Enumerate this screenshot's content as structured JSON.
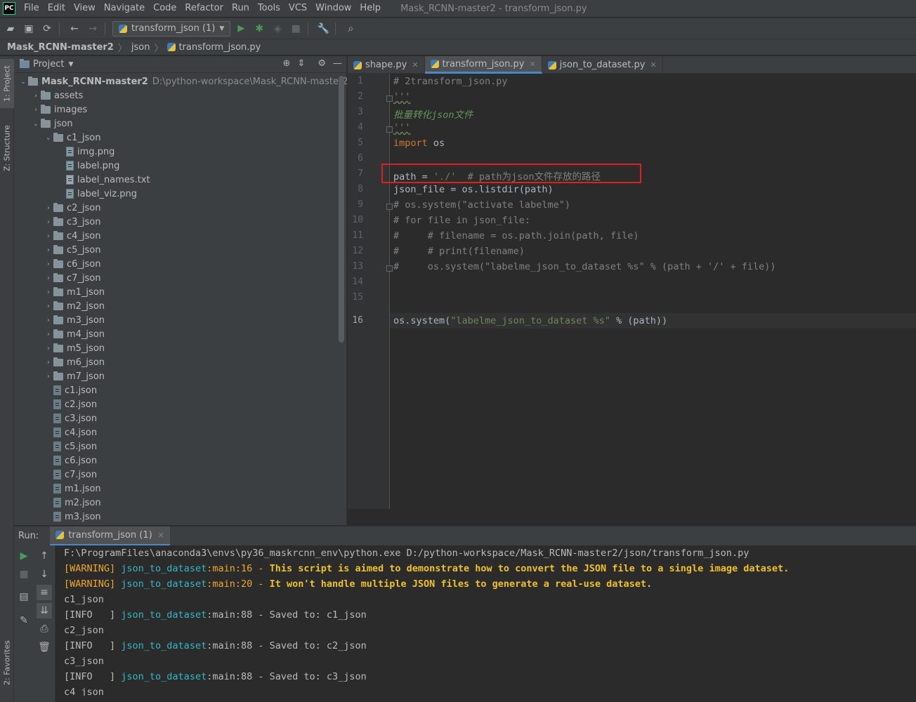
{
  "app": {
    "logo": "PC",
    "window_title": "Mask_RCNN-master2 - transform_json.py"
  },
  "menu": [
    "File",
    "Edit",
    "View",
    "Navigate",
    "Code",
    "Refactor",
    "Run",
    "Tools",
    "VCS",
    "Window",
    "Help"
  ],
  "toolbar": {
    "run_config": "transform_json (1)"
  },
  "breadcrumb": [
    "Mask_RCNN-master2",
    "json",
    "transform_json.py"
  ],
  "side_tabs": {
    "project": "1: Project",
    "structure": "Z: Structure",
    "favorites": "2: Favorites"
  },
  "project": {
    "header": "Project",
    "root_name": "Mask_RCNN-master2",
    "root_path": "D:\\python-workspace\\Mask_RCNN-master2",
    "tree": [
      {
        "label": "assets",
        "type": "folder",
        "level": 1,
        "expanded": false
      },
      {
        "label": "images",
        "type": "folder",
        "level": 1,
        "expanded": false
      },
      {
        "label": "json",
        "type": "folder",
        "level": 1,
        "expanded": true
      },
      {
        "label": "c1_json",
        "type": "folder",
        "level": 2,
        "expanded": true
      },
      {
        "label": "img.png",
        "type": "img",
        "level": 3
      },
      {
        "label": "label.png",
        "type": "img",
        "level": 3
      },
      {
        "label": "label_names.txt",
        "type": "txt",
        "level": 3
      },
      {
        "label": "label_viz.png",
        "type": "img",
        "level": 3
      },
      {
        "label": "c2_json",
        "type": "folder",
        "level": 2,
        "expanded": false
      },
      {
        "label": "c3_json",
        "type": "folder",
        "level": 2,
        "expanded": false
      },
      {
        "label": "c4_json",
        "type": "folder",
        "level": 2,
        "expanded": false
      },
      {
        "label": "c5_json",
        "type": "folder",
        "level": 2,
        "expanded": false
      },
      {
        "label": "c6_json",
        "type": "folder",
        "level": 2,
        "expanded": false
      },
      {
        "label": "c7_json",
        "type": "folder",
        "level": 2,
        "expanded": false
      },
      {
        "label": "m1_json",
        "type": "folder",
        "level": 2,
        "expanded": false
      },
      {
        "label": "m2_json",
        "type": "folder",
        "level": 2,
        "expanded": false
      },
      {
        "label": "m3_json",
        "type": "folder",
        "level": 2,
        "expanded": false
      },
      {
        "label": "m4_json",
        "type": "folder",
        "level": 2,
        "expanded": false
      },
      {
        "label": "m5_json",
        "type": "folder",
        "level": 2,
        "expanded": false
      },
      {
        "label": "m6_json",
        "type": "folder",
        "level": 2,
        "expanded": false
      },
      {
        "label": "m7_json",
        "type": "folder",
        "level": 2,
        "expanded": false
      },
      {
        "label": "c1.json",
        "type": "json",
        "level": 2
      },
      {
        "label": "c2.json",
        "type": "json",
        "level": 2
      },
      {
        "label": "c3.json",
        "type": "json",
        "level": 2
      },
      {
        "label": "c4.json",
        "type": "json",
        "level": 2
      },
      {
        "label": "c5.json",
        "type": "json",
        "level": 2
      },
      {
        "label": "c6.json",
        "type": "json",
        "level": 2
      },
      {
        "label": "c7.json",
        "type": "json",
        "level": 2
      },
      {
        "label": "m1.json",
        "type": "json",
        "level": 2
      },
      {
        "label": "m2.json",
        "type": "json",
        "level": 2
      },
      {
        "label": "m3.json",
        "type": "json",
        "level": 2
      }
    ]
  },
  "editor": {
    "tabs": [
      {
        "label": "shape.py",
        "active": false
      },
      {
        "label": "transform_json.py",
        "active": true
      },
      {
        "label": "json_to_dataset.py",
        "active": false
      }
    ],
    "current_line": 16,
    "lines": [
      {
        "n": "1",
        "tokens": [
          {
            "t": "# 2transform_json.py",
            "c": "c-comment"
          }
        ]
      },
      {
        "n": "2",
        "tokens": [
          {
            "t": "'''",
            "c": "c-doc c-wavy"
          }
        ]
      },
      {
        "n": "3",
        "tokens": [
          {
            "t": "批量转化json文件",
            "c": "c-doc"
          }
        ]
      },
      {
        "n": "4",
        "tokens": [
          {
            "t": "'''",
            "c": "c-doc c-wavy"
          }
        ]
      },
      {
        "n": "5",
        "tokens": [
          {
            "t": "import",
            "c": "c-kw"
          },
          {
            "t": " os",
            "c": "c-op"
          }
        ]
      },
      {
        "n": "6",
        "tokens": []
      },
      {
        "n": "7",
        "tokens": [
          {
            "t": "path = ",
            "c": "c-op"
          },
          {
            "t": "'./'",
            "c": "c-str"
          },
          {
            "t": "  # path为json文件存放的路径",
            "c": "c-comment"
          }
        ]
      },
      {
        "n": "8",
        "tokens": [
          {
            "t": "json_file = os.listdir(path)",
            "c": "c-op"
          }
        ]
      },
      {
        "n": "9",
        "tokens": [
          {
            "t": "# os.system(\"activate labelme\")",
            "c": "c-comment"
          }
        ]
      },
      {
        "n": "10",
        "tokens": [
          {
            "t": "# for file in json_file:",
            "c": "c-comment"
          }
        ]
      },
      {
        "n": "11",
        "tokens": [
          {
            "t": "#     # filename = os.path.join(path, file)",
            "c": "c-comment"
          }
        ]
      },
      {
        "n": "12",
        "tokens": [
          {
            "t": "#     # print(filename)",
            "c": "c-comment"
          }
        ]
      },
      {
        "n": "13",
        "tokens": [
          {
            "t": "#     os.system(\"labelme_json_to_dataset %s\" % (path + '/' + file))",
            "c": "c-comment"
          }
        ]
      },
      {
        "n": "14",
        "tokens": []
      },
      {
        "n": "15",
        "tokens": []
      },
      {
        "n": "16",
        "tokens": [
          {
            "t": "os.system(",
            "c": "c-op"
          },
          {
            "t": "\"labelme_json_to_dataset %s\"",
            "c": "c-str"
          },
          {
            "t": " % (path))",
            "c": "c-op"
          }
        ]
      }
    ]
  },
  "run": {
    "label": "Run:",
    "tab": "transform_json (1)",
    "console": [
      [
        {
          "t": "F:\\ProgramFiles\\anaconda3\\envs\\py36_maskrcnn_env\\python.exe D:/python-workspace/Mask_RCNN-master2/json/transform_json.py",
          "c": "con-info"
        }
      ],
      [
        {
          "t": "[WARNING] ",
          "c": "con-warn"
        },
        {
          "t": "json_to_dataset",
          "c": "con-blue"
        },
        {
          "t": ":main:16 - ",
          "c": "con-warn"
        },
        {
          "t": "This script is aimed to demonstrate how to convert the JSON file to a single image dataset.",
          "c": "con-bold"
        }
      ],
      [
        {
          "t": "[WARNING] ",
          "c": "con-warn"
        },
        {
          "t": "json_to_dataset",
          "c": "con-blue"
        },
        {
          "t": ":main:20 - ",
          "c": "con-warn"
        },
        {
          "t": "It won't handle multiple JSON files to generate a real-use dataset.",
          "c": "con-bold"
        }
      ],
      [
        {
          "t": "c1_json",
          "c": "con-info"
        }
      ],
      [
        {
          "t": "[INFO   ] ",
          "c": "con-info"
        },
        {
          "t": "json_to_dataset",
          "c": "con-blue"
        },
        {
          "t": ":main:88 - Saved to: c1_json",
          "c": "con-info"
        }
      ],
      [
        {
          "t": "c2_json",
          "c": "con-info"
        }
      ],
      [
        {
          "t": "[INFO   ] ",
          "c": "con-info"
        },
        {
          "t": "json_to_dataset",
          "c": "con-blue"
        },
        {
          "t": ":main:88 - Saved to: c2_json",
          "c": "con-info"
        }
      ],
      [
        {
          "t": "c3_json",
          "c": "con-info"
        }
      ],
      [
        {
          "t": "[INFO   ] ",
          "c": "con-info"
        },
        {
          "t": "json_to_dataset",
          "c": "con-blue"
        },
        {
          "t": ":main:88 - Saved to: c3_json",
          "c": "con-info"
        }
      ],
      [
        {
          "t": "c4_json",
          "c": "con-info"
        }
      ]
    ]
  },
  "colors": {
    "accent": "#4a88c7",
    "highlight_box": "#e02020",
    "run_green": "#499c54"
  }
}
